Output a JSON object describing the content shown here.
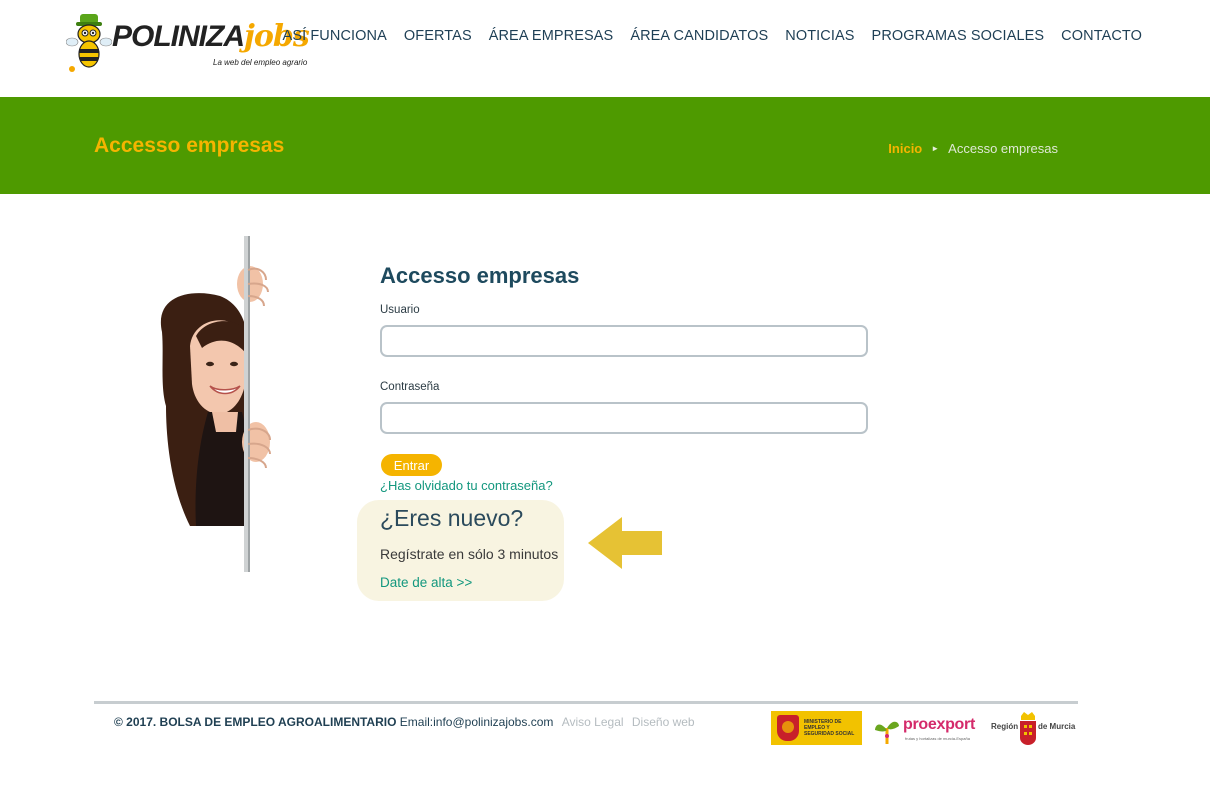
{
  "header": {
    "logo": {
      "word_main": "POLINIZA",
      "word_accent": "jobs",
      "tagline": "La web del empleo agrario"
    },
    "nav": [
      "ASÍ FUNCIONA",
      "OFERTAS",
      "ÁREA EMPRESAS",
      "ÁREA CANDIDATOS",
      "NOTICIAS",
      "PROGRAMAS SOCIALES",
      "CONTACTO"
    ]
  },
  "banner": {
    "title": "Accesso empresas",
    "breadcrumb": {
      "home": "Inicio",
      "separator": "►",
      "current": "Accesso empresas"
    }
  },
  "form": {
    "title": "Accesso empresas",
    "user_label": "Usuario",
    "user_value": "",
    "password_label": "Contraseña",
    "password_value": "",
    "submit_label": "Entrar",
    "forgot_link": "¿Has olvidado tu contraseña?"
  },
  "register": {
    "title": "¿Eres nuevo?",
    "subtitle": "Regístrate en sólo 3 minutos",
    "link": "Date de alta >>"
  },
  "footer": {
    "copyright": "© 2017. BOLSA DE EMPLEO AGROALIMENTARIO",
    "email": "Email:info@polinizajobs.com",
    "legal_link": "Aviso Legal",
    "design_link": "Diseño web",
    "partners": {
      "ministry": "MINISTERIO DE EMPLEO Y SEGURIDAD SOCIAL",
      "proexport": "proexport",
      "proexport_tag": "frutas y hortalizas de murcia-España",
      "murcia_region": "Región",
      "murcia_de": "de Murcia"
    }
  },
  "colors": {
    "banner_green": "#4e9a00",
    "accent_yellow": "#f5b400",
    "link_teal": "#13977e",
    "nav_text": "#1e3f55",
    "register_box_bg": "#f8f4e1",
    "arrow": "#e6c234"
  }
}
